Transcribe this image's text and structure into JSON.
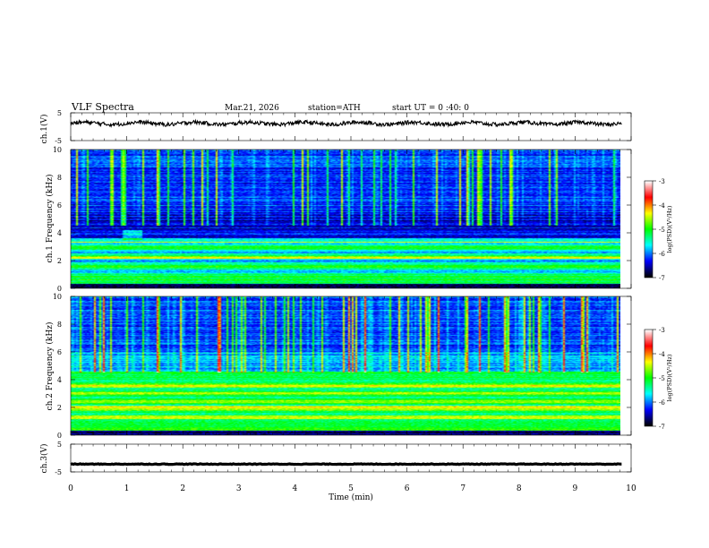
{
  "header": {
    "title": "VLF  Spectra",
    "date": "Mar.21, 2026",
    "station": "station=ATH",
    "start": "start  UT  =   0 :40: 0"
  },
  "chart_data": [
    {
      "type": "line",
      "panel": "ch1-waveform",
      "ylabel": "ch.1(V)",
      "ylim": [
        -5,
        5
      ],
      "yticks": [
        "5",
        "-5"
      ],
      "xlim": [
        0,
        10
      ],
      "baseline": 1.2
    },
    {
      "type": "heatmap",
      "panel": "ch1-spectrogram",
      "ylabel": "ch.1 Frequency (kHz)",
      "ylim": [
        0,
        10
      ],
      "yticks": [
        "0",
        "2",
        "4",
        "6",
        "8",
        "10"
      ],
      "xlim": [
        0,
        10
      ],
      "colorbar": {
        "label": "log(PSD)(V²/Hz)",
        "ticks": [
          "-3",
          "-4",
          "-5",
          "-6",
          "-7"
        ],
        "range": [
          -7,
          -3
        ]
      }
    },
    {
      "type": "heatmap",
      "panel": "ch2-spectrogram",
      "ylabel": "ch.2 Frequency (kHz)",
      "ylim": [
        0,
        10
      ],
      "yticks": [
        "0",
        "2",
        "4",
        "6",
        "8",
        "10"
      ],
      "xlim": [
        0,
        10
      ],
      "colorbar": {
        "label": "log(PSD)(V²/Hz)",
        "ticks": [
          "-3",
          "-4",
          "-5",
          "-6",
          "-7"
        ],
        "range": [
          -7,
          -3
        ]
      }
    },
    {
      "type": "line",
      "panel": "ch3-waveform",
      "ylabel": "ch.3(V)",
      "ylim": [
        -5,
        5
      ],
      "yticks": [
        "5",
        "-5"
      ],
      "xlim": [
        0,
        10
      ],
      "baseline": -2.2
    }
  ],
  "xaxis": {
    "label": "Time  (min)",
    "ticks": [
      "0",
      "1",
      "2",
      "3",
      "4",
      "5",
      "6",
      "7",
      "8",
      "9",
      "10"
    ],
    "data_end": 9.83
  },
  "colors": {
    "colormap": [
      "#000000",
      "#0000ff",
      "#00ffff",
      "#00ff00",
      "#ffff00",
      "#ff0000",
      "#ffffff"
    ]
  }
}
